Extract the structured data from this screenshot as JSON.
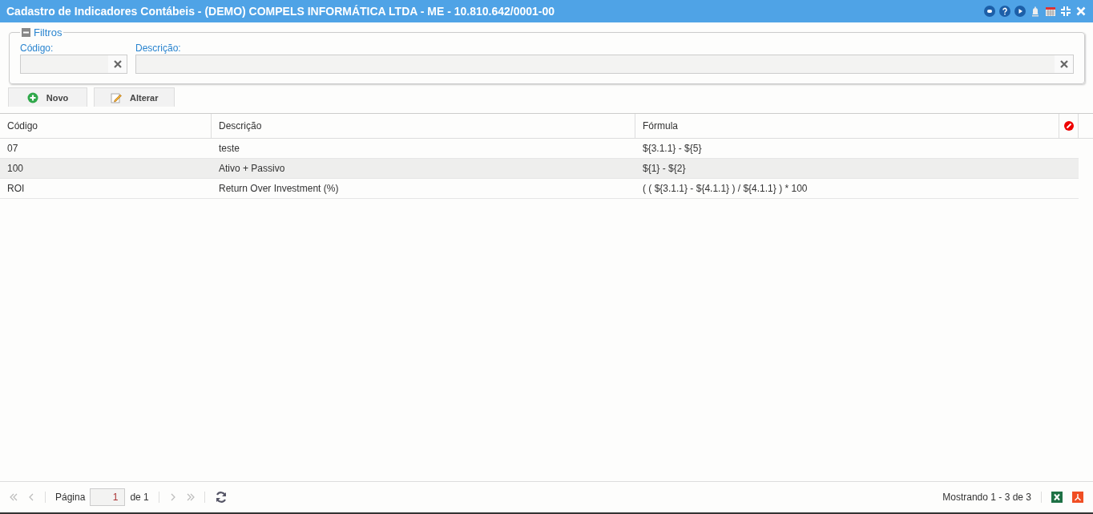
{
  "window": {
    "title": "Cadastro de Indicadores Contábeis - (DEMO) COMPELS INFORMÁTICA LTDA - ME - 10.810.642/0001-00"
  },
  "filters": {
    "legend": "Filtros",
    "expanded": true,
    "fields": [
      {
        "label": "Código:"
      },
      {
        "label": "Descrição:"
      }
    ]
  },
  "buttons": [
    {
      "label": "Novo",
      "kind": "add"
    },
    {
      "label": "Alterar",
      "kind": "edit"
    }
  ],
  "table": {
    "columns": [
      "Código",
      "Descrição",
      "Fórmula"
    ],
    "rows": [
      {
        "cells": [
          "07",
          "teste",
          "${3.1.1} - ${5}"
        ],
        "selected": false
      },
      {
        "cells": [
          "100",
          "Ativo + Passivo",
          "${1} - ${2}"
        ],
        "selected": true
      },
      {
        "cells": [
          "ROI",
          "Return Over Investment (%)",
          "( ( ${3.1.1} - ${4.1.1} ) / ${4.1.1} ) * 100"
        ],
        "selected": false
      }
    ]
  },
  "pager": {
    "page_label": "Página",
    "page": "1",
    "of": "de 1",
    "summary": "Mostrando 1 - 3 de 3"
  }
}
